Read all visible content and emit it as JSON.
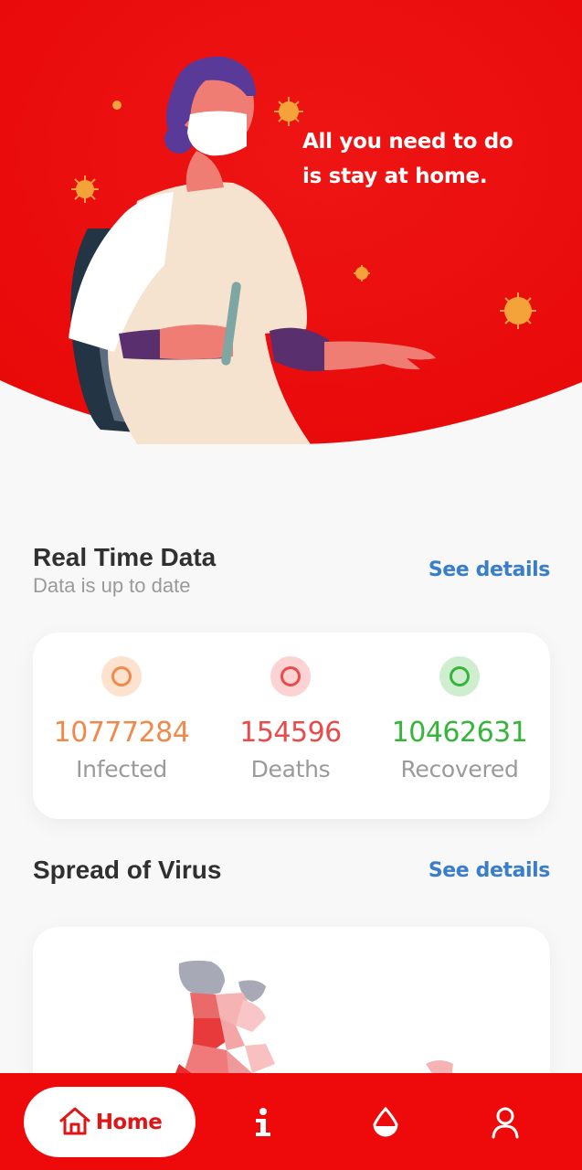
{
  "hero": {
    "line1": "All you need to do",
    "line2": "is stay at home."
  },
  "colors": {
    "brand_red": "#ee0a0a",
    "link_blue": "#3a7dc9",
    "infected": "#f08a4b",
    "deaths": "#ea4a4a",
    "recovered": "#36b53a"
  },
  "realtime": {
    "title": "Real Time Data",
    "subtitle": "Data is up to date",
    "see_details": "See details",
    "stats": [
      {
        "value": "10777284",
        "label": "Infected",
        "icon": "infected-dot-icon"
      },
      {
        "value": "154596",
        "label": "Deaths",
        "icon": "deaths-dot-icon"
      },
      {
        "value": "10462631",
        "label": "Recovered",
        "icon": "recovered-dot-icon"
      }
    ]
  },
  "spread": {
    "title": "Spread of Virus",
    "see_details": "See details"
  },
  "nav": {
    "items": [
      {
        "label": "Home",
        "icon": "home-icon"
      },
      {
        "icon": "info-icon"
      },
      {
        "icon": "drop-icon"
      },
      {
        "icon": "user-icon"
      }
    ]
  }
}
